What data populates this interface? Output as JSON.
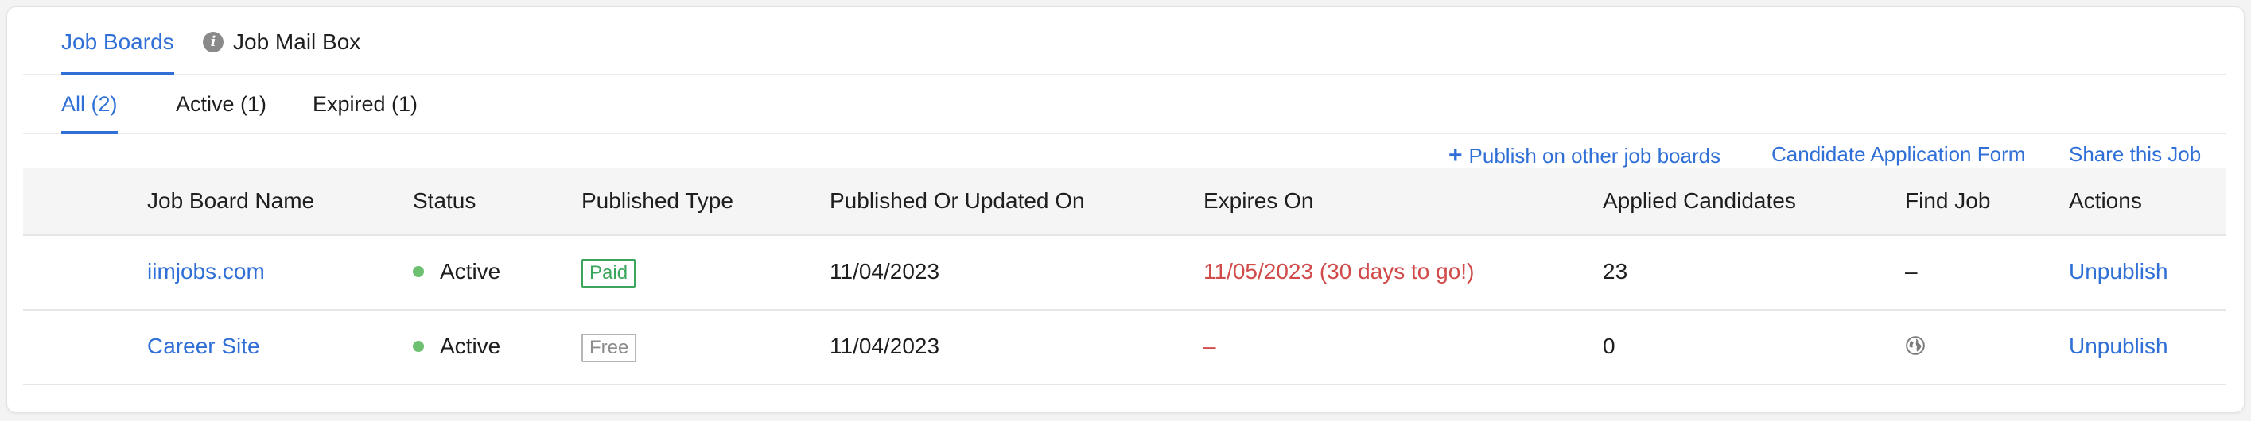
{
  "tabs": {
    "job_boards": "Job Boards",
    "job_mail_box": "Job Mail Box"
  },
  "filters": {
    "all": "All (2)",
    "active": "Active (1)",
    "expired": "Expired (1)"
  },
  "links": {
    "publish_other": "Publish on other job boards",
    "candidate_form": "Candidate Application Form",
    "share_job": "Share this Job"
  },
  "table": {
    "headers": {
      "name": "Job Board Name",
      "status": "Status",
      "type": "Published Type",
      "published": "Published Or Updated On",
      "expires": "Expires On",
      "applied": "Applied Candidates",
      "find": "Find Job",
      "actions": "Actions"
    },
    "rows": [
      {
        "name": "iimjobs.com",
        "status": "Active",
        "type": "Paid",
        "published": "11/04/2023",
        "expires": "11/05/2023 (30 days to go!)",
        "applied": "23",
        "find": "–",
        "action": "Unpublish"
      },
      {
        "name": "Career Site",
        "status": "Active",
        "type": "Free",
        "published": "11/04/2023",
        "expires": "–",
        "applied": "0",
        "find_icon": "globe-icon",
        "action": "Unpublish"
      }
    ]
  },
  "colors": {
    "accent": "#2f6fd6",
    "active_dot": "#6cc070",
    "paid": "#3ba55c",
    "free": "#8c8c8c",
    "expires": "#d14b4b"
  }
}
